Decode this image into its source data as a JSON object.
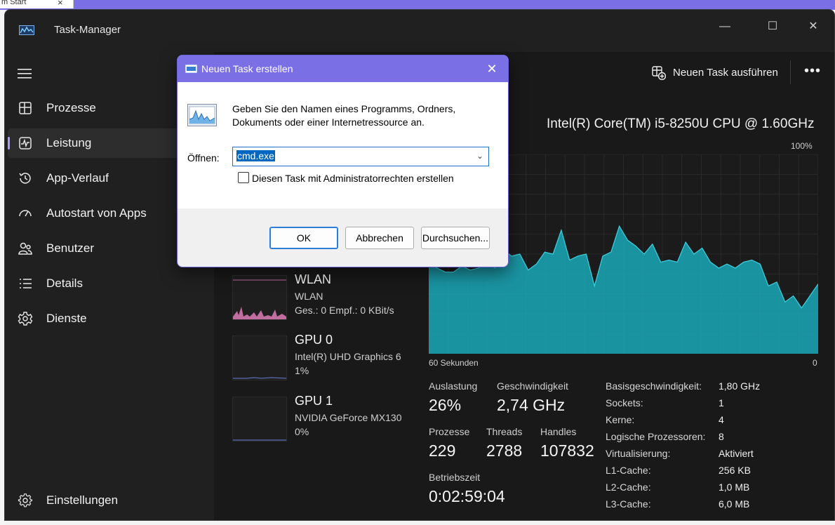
{
  "background": {
    "tab_title": "m Start",
    "tab_close": "×"
  },
  "window": {
    "title": "Task-Manager",
    "controls": {
      "minimize": "—",
      "maximize": "☐",
      "close": "✕"
    }
  },
  "sidebar": {
    "items": [
      {
        "label": "Prozesse",
        "icon": "processes-icon"
      },
      {
        "label": "Leistung",
        "icon": "performance-icon",
        "active": true
      },
      {
        "label": "App-Verlauf",
        "icon": "history-icon"
      },
      {
        "label": "Autostart von Apps",
        "icon": "startup-icon"
      },
      {
        "label": "Benutzer",
        "icon": "users-icon"
      },
      {
        "label": "Details",
        "icon": "details-icon"
      },
      {
        "label": "Dienste",
        "icon": "services-icon"
      }
    ],
    "settings": {
      "label": "Einstellungen",
      "icon": "settings-icon"
    }
  },
  "toolbar": {
    "new_task_label": "Neuen Task ausführen",
    "more_label": "•••"
  },
  "cpu": {
    "title": "Intel(R) Core(TM) i5-8250U CPU @ 1.60GHz",
    "max_label": "100%",
    "x_left": "60 Sekunden",
    "x_right": "0",
    "graph_color": "#1aa8b8",
    "history": [
      46,
      43,
      41,
      41,
      44,
      42,
      43,
      46,
      43,
      52,
      49,
      50,
      42,
      45,
      51,
      50,
      62,
      47,
      49,
      50,
      34,
      49,
      51,
      64,
      57,
      54,
      50,
      55,
      46,
      47,
      46,
      56,
      50,
      53,
      46,
      43,
      45,
      43,
      46,
      47,
      45,
      34,
      36,
      26,
      29,
      23,
      29,
      35
    ],
    "stats": {
      "auslastung_label": "Auslastung",
      "auslastung": "26%",
      "geschwindigkeit_label": "Geschwindigkeit",
      "geschwindigkeit": "2,74 GHz",
      "prozesse_label": "Prozesse",
      "prozesse": "229",
      "threads_label": "Threads",
      "threads": "2788",
      "handles_label": "Handles",
      "handles": "107832",
      "betriebszeit_label": "Betriebszeit",
      "betriebszeit": "0:02:59:04"
    },
    "info": [
      {
        "label": "Basisgeschwindigkeit:",
        "value": "1,80 GHz"
      },
      {
        "label": "Sockets:",
        "value": "1"
      },
      {
        "label": "Kerne:",
        "value": "4"
      },
      {
        "label": "Logische Prozessoren:",
        "value": "8"
      },
      {
        "label": "Virtualisierung:",
        "value": "Aktiviert"
      },
      {
        "label": "L1-Cache:",
        "value": "256 KB"
      },
      {
        "label": "L2-Cache:",
        "value": "1,0 MB"
      },
      {
        "label": "L3-Cache:",
        "value": "6,0 MB"
      }
    ]
  },
  "devices": [
    {
      "name": "WLAN",
      "sub1": "WLAN",
      "sub2": "Ges.: 0 Empf.: 0 KBit/s"
    },
    {
      "name": "GPU 0",
      "sub1": "Intel(R) UHD Graphics 6",
      "sub2": "1%"
    },
    {
      "name": "GPU 1",
      "sub1": "NVIDIA GeForce MX130",
      "sub2": "0%"
    }
  ],
  "dialog": {
    "title": "Neuen Task erstellen",
    "close": "✕",
    "desc_line1": "Geben Sie den Namen eines Programms, Ordners,",
    "desc_line2": "Dokuments oder einer Internetressource an.",
    "open_label": "Öffnen:",
    "open_value": "cmd.exe",
    "admin_checkbox_label": "Diesen Task mit Administratorrechten erstellen",
    "admin_checked": false,
    "ok_label": "OK",
    "cancel_label": "Abbrechen",
    "browse_label": "Durchsuchen..."
  }
}
